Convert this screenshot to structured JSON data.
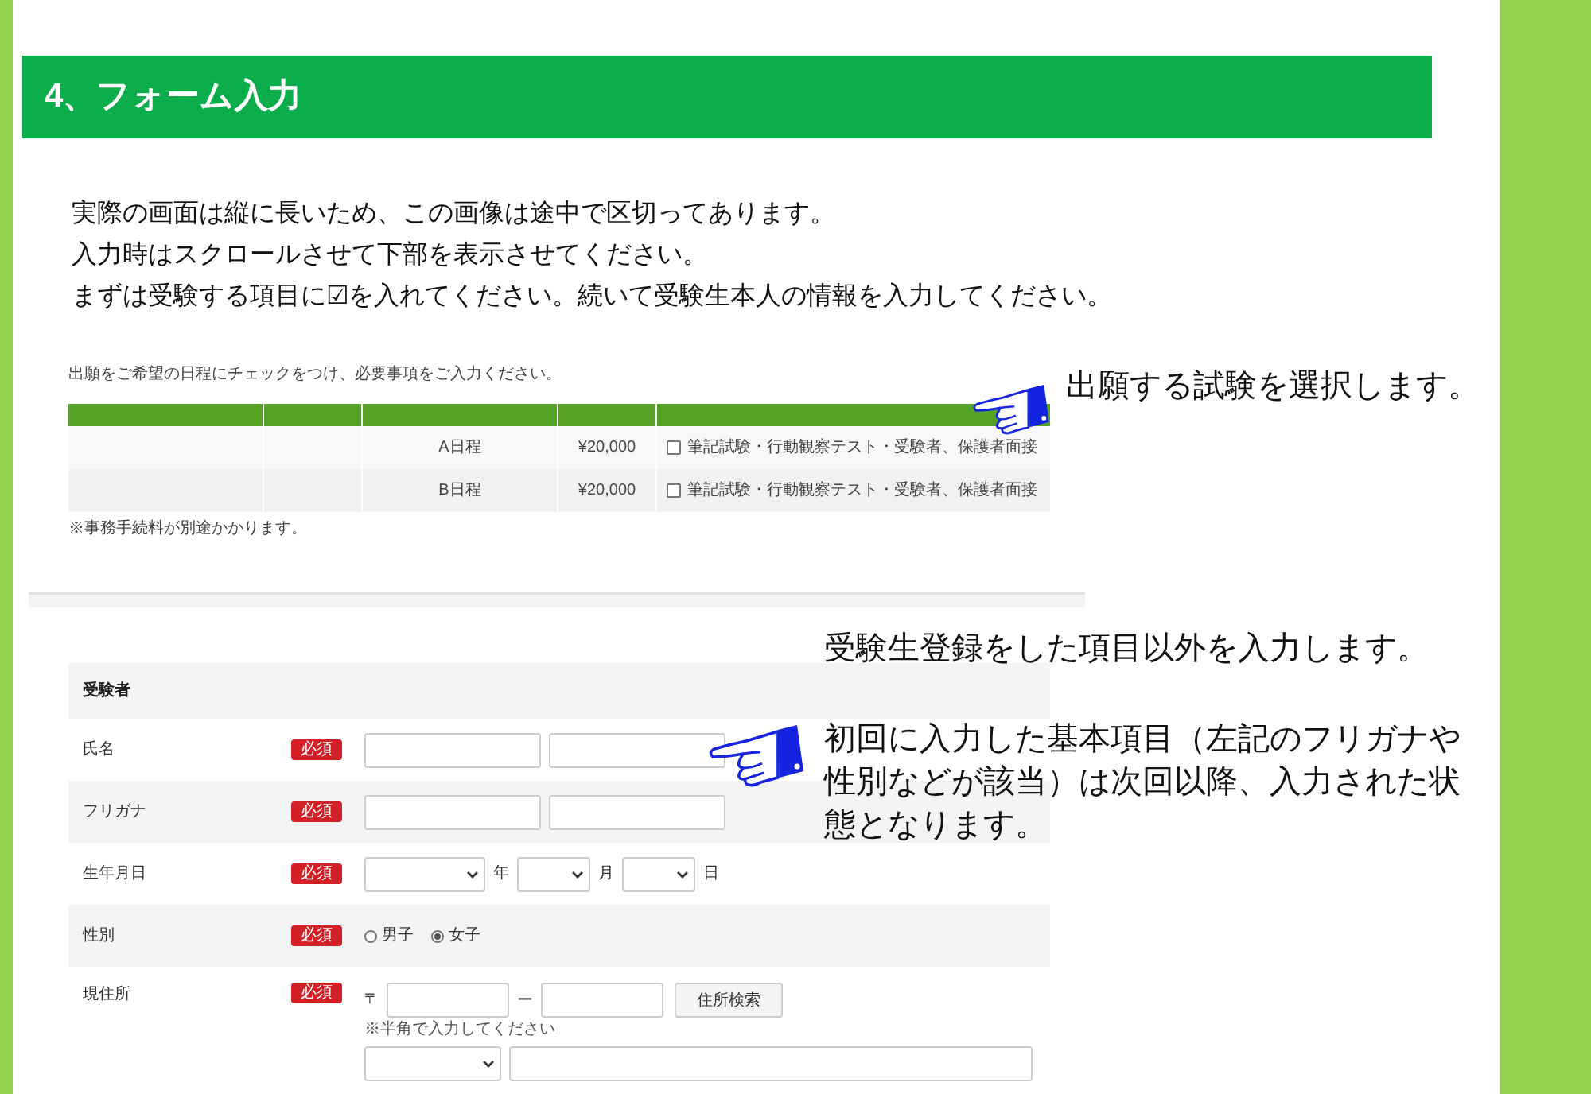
{
  "heading": "4、フォーム入力",
  "intro_lines": [
    "実際の画面は縦に長いため、この画像は途中で区切ってあります。",
    "入力時はスクロールさせて下部を表示させてください。",
    "まずは受験する項目に☑を入れてください。続いて受験生本人の情報を入力してください。"
  ],
  "exam_table": {
    "instruction": "出願をご希望の日程にチェックをつけ、必要事項をご入力ください。",
    "rows": [
      {
        "date": "A日程",
        "price": "¥20,000",
        "option": "筆記試験・行動観察テスト・受験者、保護者面接",
        "checked": false
      },
      {
        "date": "B日程",
        "price": "¥20,000",
        "option": "筆記試験・行動観察テスト・受験者、保護者面接",
        "checked": false
      }
    ],
    "note": "※事務手続料が別途かかります。"
  },
  "callouts": [
    "出願する試験を選択します。",
    "受験生登録をした項目以外を入力します。",
    "初回に入力した基本項目（左記のフリガナや性別などが該当）は次回以降、入力された状態となります。"
  ],
  "form": {
    "section_title": "受験者",
    "rows": [
      {
        "kind": "name",
        "label": "氏名",
        "badge": "必須"
      },
      {
        "kind": "name",
        "label": "フリガナ",
        "badge": "必須"
      },
      {
        "kind": "date",
        "label": "生年月日",
        "badge": "必須",
        "units": [
          "年",
          "月",
          "日"
        ]
      },
      {
        "kind": "radio",
        "label": "性別",
        "badge": "必須",
        "options": [
          {
            "label": "男子",
            "selected": false
          },
          {
            "label": "女子",
            "selected": true
          }
        ]
      },
      {
        "kind": "address",
        "label": "現住所",
        "badge": "必須",
        "postal_mark": "〒",
        "dash": "ー",
        "button": "住所検索",
        "hint": "※半角で入力してください"
      }
    ]
  }
}
